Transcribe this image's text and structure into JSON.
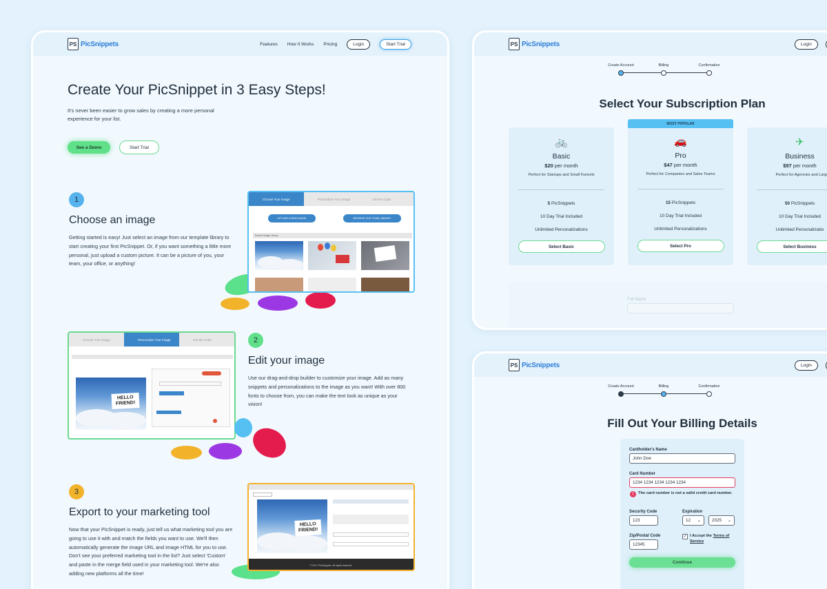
{
  "brand": {
    "logo_mark": "PS",
    "name": "PicSnippets"
  },
  "nav": {
    "features": "Features",
    "how": "How It Works",
    "pricing": "Pricing",
    "login": "Login",
    "trial": "Start Trial"
  },
  "hero": {
    "title": "Create Your PicSnippet in 3 Easy Steps!",
    "subtitle": "It's never been easier to grow sales by creating a more personal experience for your list.",
    "demo_btn": "See a Demo",
    "trial_btn": "Start Trial"
  },
  "steps": [
    {
      "num": "1",
      "title": "Choose an image",
      "body": "Getting started is easy! Just select an image from our template library to start creating your first PicSnippet. Or, if you want something a little more personal, just upload a custom picture. It can be a picture of you, your team, your office, or anything!"
    },
    {
      "num": "2",
      "title": "Edit your image",
      "body": "Use our drag-and-drop builder to customize your image. Add as many snippets and personalizations to the image as you want! With over 800 fonts to choose from, you can make the text look as unique as your vision!"
    },
    {
      "num": "3",
      "title": "Export to your marketing tool",
      "body": "Now that your PicSnippet is ready, just tell us what marketing tool you are going to use it with and match the fields you want to use. We'll then automatically generate the image URL and image HTML for you to use. Don't see your preferred marketing tool in the list? Just select 'Custom' and paste in the merge field used in your marketing tool. We're also adding new platforms all the time!"
    }
  ],
  "mock1": {
    "tab1": "Choose Your Image",
    "tab2": "Personalize Your Image",
    "tab3": "Get the Code",
    "upload": "UPLOAD A NEW IMAGE",
    "browse": "BROWSE OUR TEAM LIBRARY",
    "recent": "Recent Image Library"
  },
  "mock2": {
    "tab1": "Choose Your Image",
    "tab2": "Personalize Your Image",
    "tab3": "Get the Code",
    "sign": "HELLO FRIEND!"
  },
  "mock3": {
    "sign": "HELLO FRIEND!",
    "footer": "© 2017 PicSnippets. All rights reserved."
  },
  "signup_steps": {
    "s1": "Create Account",
    "s2": "Billing",
    "s3": "Confirmation"
  },
  "subscription": {
    "title": "Select Your Subscription Plan",
    "popular": "MOST POPULAR",
    "plans": [
      {
        "icon": "bicycle-icon",
        "glyph": "🚲",
        "name": "Basic",
        "price": "$20",
        "period": "per month",
        "desc": "Perfect for Startups and Small Funnels",
        "snip_count": "5",
        "snip_label": "PicSnippets",
        "trial": "10 Day Trial Included",
        "personal": "Unlimited Personalizations",
        "btn": "Select Basic"
      },
      {
        "icon": "car-icon",
        "glyph": "🚗",
        "name": "Pro",
        "price": "$47",
        "period": "per month",
        "desc": "Perfect for Companies and Sales Teams",
        "snip_count": "15",
        "snip_label": "PicSnippets",
        "trial": "10 Day Trial Included",
        "personal": "Unlimited Personalizations",
        "btn": "Select Pro"
      },
      {
        "icon": "airplane-icon",
        "glyph": "✈",
        "name": "Business",
        "price": "$97",
        "period": "per month",
        "desc": "Perfect for Agencies and Large T",
        "snip_count": "50",
        "snip_label": "PicSnippets",
        "trial": "10 Day Trial Included",
        "personal": "Unlimited Personalizatio",
        "btn": "Select Business"
      }
    ],
    "full_name_label": "Full Name"
  },
  "billing": {
    "title": "Fill Out Your Billing Details",
    "holder_label": "Cardholder's Name",
    "holder_value": "John Doe",
    "card_label": "Card Number",
    "card_value": "1234 1234 1234 1234 1234",
    "card_error": "The card number is not a valid credit card number.",
    "cvc_label": "Security Code",
    "cvc_value": "123",
    "exp_label": "Expiration",
    "exp_month": "12",
    "exp_year": "2025",
    "zip_label": "Zip/Postal Code",
    "zip_value": "12345",
    "terms_prefix": "I Accept the ",
    "terms_link": "Terms of Service",
    "continue": "Continue"
  },
  "colors": {
    "accent": "#2c7ed6",
    "green": "#5fe089",
    "error": "#e33b5e",
    "popular": "#56c0f3"
  }
}
